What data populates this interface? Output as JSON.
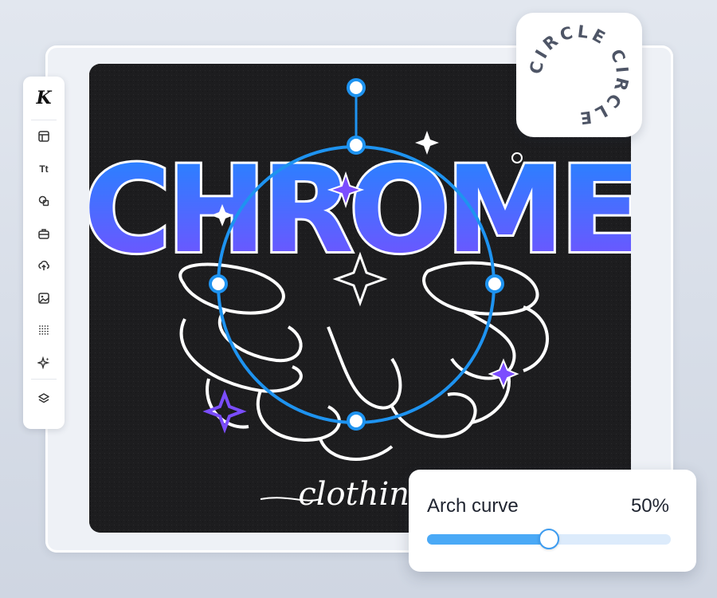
{
  "toolbar": {
    "logo": "K",
    "items": [
      {
        "name": "layout-icon"
      },
      {
        "name": "text",
        "label": "Tt"
      },
      {
        "name": "shapes-icon"
      },
      {
        "name": "toolkit-icon"
      },
      {
        "name": "upload-icon"
      },
      {
        "name": "image-icon"
      },
      {
        "name": "pattern-icon"
      },
      {
        "name": "sparkle-icon"
      }
    ],
    "bottom": {
      "name": "layers-icon"
    }
  },
  "badge": {
    "text": "CIRCLE CIRCLE "
  },
  "artwork": {
    "headline": "CHROME",
    "script": "clothing",
    "gradient": [
      "#1e88ff",
      "#7b4dff"
    ],
    "accent": "#7b4dff"
  },
  "arch_control": {
    "label": "Arch curve",
    "value_text": "50%",
    "value": 0.5,
    "accent": "#4aa9f6"
  }
}
